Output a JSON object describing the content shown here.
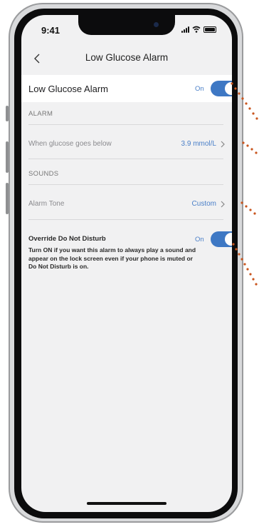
{
  "status_bar": {
    "time": "9:41"
  },
  "nav": {
    "title": "Low Glucose Alarm"
  },
  "main_toggle": {
    "label": "Low Glucose Alarm",
    "state": "On"
  },
  "alarm_section": {
    "header": "ALARM",
    "threshold": {
      "label": "When glucose goes below",
      "value": "3.9 mmol/L"
    }
  },
  "sounds_section": {
    "header": "SOUNDS",
    "tone": {
      "label": "Alarm Tone",
      "value": "Custom"
    }
  },
  "override": {
    "title": "Override Do Not Disturb",
    "state": "On",
    "description": "Turn ON if you want this alarm to always play a sound and appear on the lock screen even if your phone is muted or Do Not Disturb is on."
  },
  "colors": {
    "accent": "#3e78c4",
    "callout": "#c9551e",
    "background": "#f1f1f2"
  }
}
